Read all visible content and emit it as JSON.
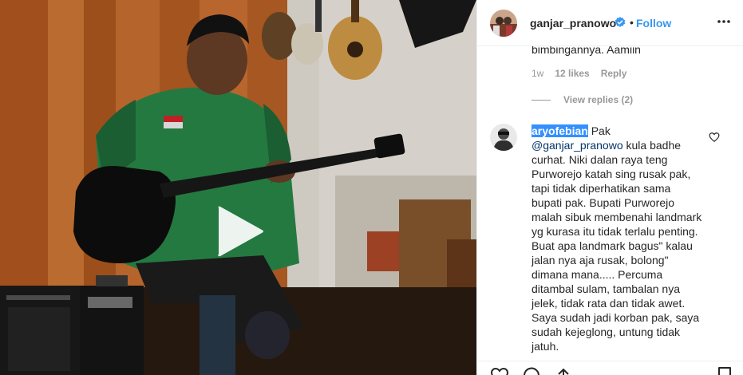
{
  "post": {
    "username": "ganjar_pranowo",
    "separator": "•",
    "follow_label": "Follow",
    "verified": true
  },
  "previous_comment": {
    "text_fragment": "bimbingannya. Aamiin",
    "age": "1w",
    "likes": "12 likes",
    "reply_label": "Reply",
    "view_replies_label": "View replies (2)"
  },
  "comment": {
    "username": "aryofebian",
    "prefix": " Pak ",
    "mention": "@ganjar_pranowo",
    "text": " kula badhe curhat. Niki dalan raya teng Purworejo katah sing rusak pak, tapi tidak diperhatikan sama bupati pak. Bupati Purworejo malah sibuk membenahi landmark yg kurasa itu tidak terlalu penting. Buat apa landmark bagus\" kalau jalan nya aja rusak, bolong\" dimana mana..... Percuma ditambal sulam, tambalan nya jelek, tidak rata dan tidak awet. Saya sudah jadi korban pak, saya sudah kejeglong, untung tidak jatuh."
  },
  "icons": {
    "verified": "verified-badge-icon",
    "more": "more-options-icon",
    "like": "heart-icon",
    "comment": "comment-icon",
    "share": "share-icon",
    "save": "bookmark-icon",
    "play": "play-icon"
  },
  "colors": {
    "link_blue": "#3897f0",
    "mention_blue": "#003569",
    "highlight": "#3390ff",
    "muted": "#999999",
    "text": "#262626"
  }
}
